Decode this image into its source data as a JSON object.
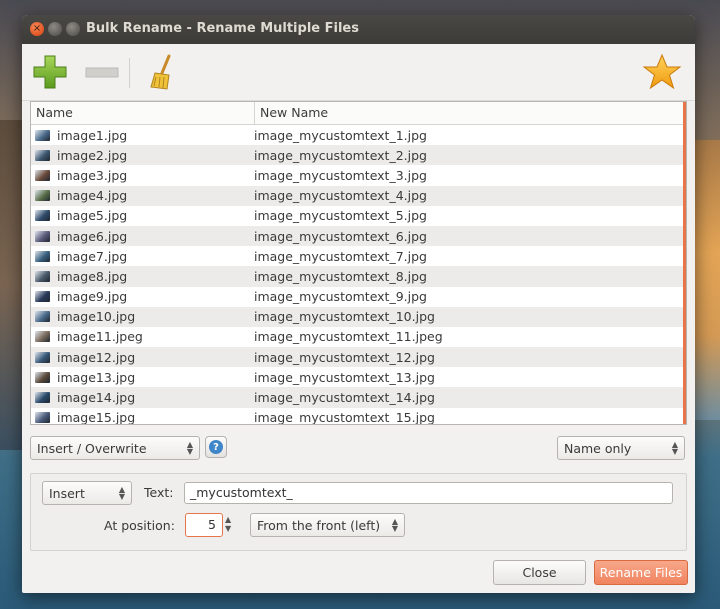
{
  "window": {
    "title": "Bulk Rename - Rename Multiple Files"
  },
  "toolbar": {
    "add_icon": "plus-icon",
    "remove_icon": "minus-icon",
    "clear_icon": "broom-icon",
    "favorite_icon": "star-icon"
  },
  "list": {
    "headers": {
      "name": "Name",
      "new_name": "New Name"
    },
    "rows": [
      {
        "name": "image1.jpg",
        "new_name": "image_mycustomtext_1.jpg"
      },
      {
        "name": "image2.jpg",
        "new_name": "image_mycustomtext_2.jpg"
      },
      {
        "name": "image3.jpg",
        "new_name": "image_mycustomtext_3.jpg"
      },
      {
        "name": "image4.jpg",
        "new_name": "image_mycustomtext_4.jpg"
      },
      {
        "name": "image5.jpg",
        "new_name": "image_mycustomtext_5.jpg"
      },
      {
        "name": "image6.jpg",
        "new_name": "image_mycustomtext_6.jpg"
      },
      {
        "name": "image7.jpg",
        "new_name": "image_mycustomtext_7.jpg"
      },
      {
        "name": "image8.jpg",
        "new_name": "image_mycustomtext_8.jpg"
      },
      {
        "name": "image9.jpg",
        "new_name": "image_mycustomtext_9.jpg"
      },
      {
        "name": "image10.jpg",
        "new_name": "image_mycustomtext_10.jpg"
      },
      {
        "name": "image11.jpeg",
        "new_name": "image_mycustomtext_11.jpeg"
      },
      {
        "name": "image12.jpg",
        "new_name": "image_mycustomtext_12.jpg"
      },
      {
        "name": "image13.jpg",
        "new_name": "image_mycustomtext_13.jpg"
      },
      {
        "name": "image14.jpg",
        "new_name": "image_mycustomtext_14.jpg"
      },
      {
        "name": "image15.jpg",
        "new_name": "image_mycustomtext_15.jpg"
      }
    ]
  },
  "controls": {
    "mode_select": "Insert / Overwrite",
    "help_label": "?",
    "scope_select": "Name only",
    "action_select": "Insert",
    "text_label": "Text:",
    "text_value": "_mycustomtext_",
    "position_label": "At position:",
    "position_value": "5",
    "direction_select": "From the front (left)"
  },
  "buttons": {
    "close": "Close",
    "rename": "Rename Files"
  },
  "colors": {
    "accent": "#e8744a",
    "title_bar": "#3c3b37",
    "row_alt": "#ecebe9"
  }
}
